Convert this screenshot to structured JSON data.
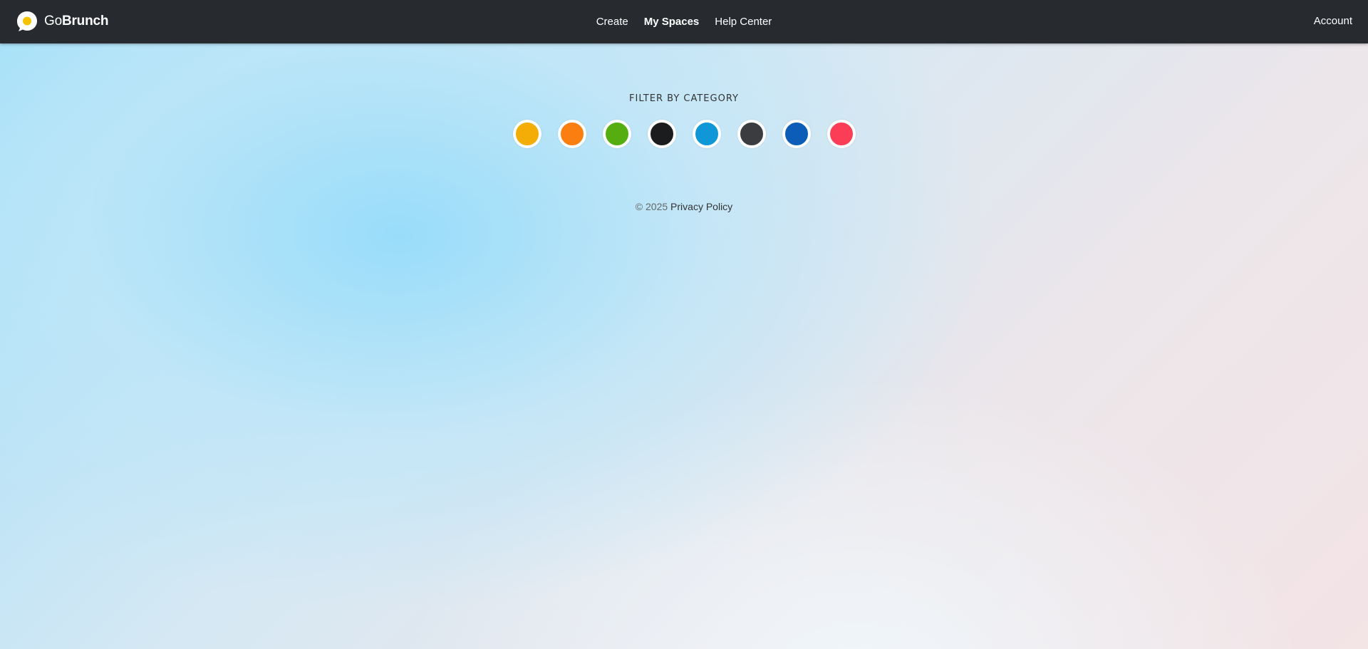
{
  "header": {
    "brand": {
      "light": "Go",
      "bold": "Brunch",
      "logo_icon": "speech-bubble-yolk-icon"
    },
    "nav": [
      {
        "label": "Create",
        "active": false
      },
      {
        "label": "My Spaces",
        "active": true
      },
      {
        "label": "Help Center",
        "active": false
      }
    ],
    "account_label": "Account"
  },
  "filter": {
    "title": "FILTER BY CATEGORY",
    "colors": [
      "#f4ac06",
      "#fb7e10",
      "#56ad0f",
      "#1b1c1e",
      "#0f97d7",
      "#3a3c40",
      "#0b5db8",
      "#fb3e55"
    ]
  },
  "footer": {
    "copyright": "© 2025",
    "privacy_label": "Privacy Policy"
  }
}
